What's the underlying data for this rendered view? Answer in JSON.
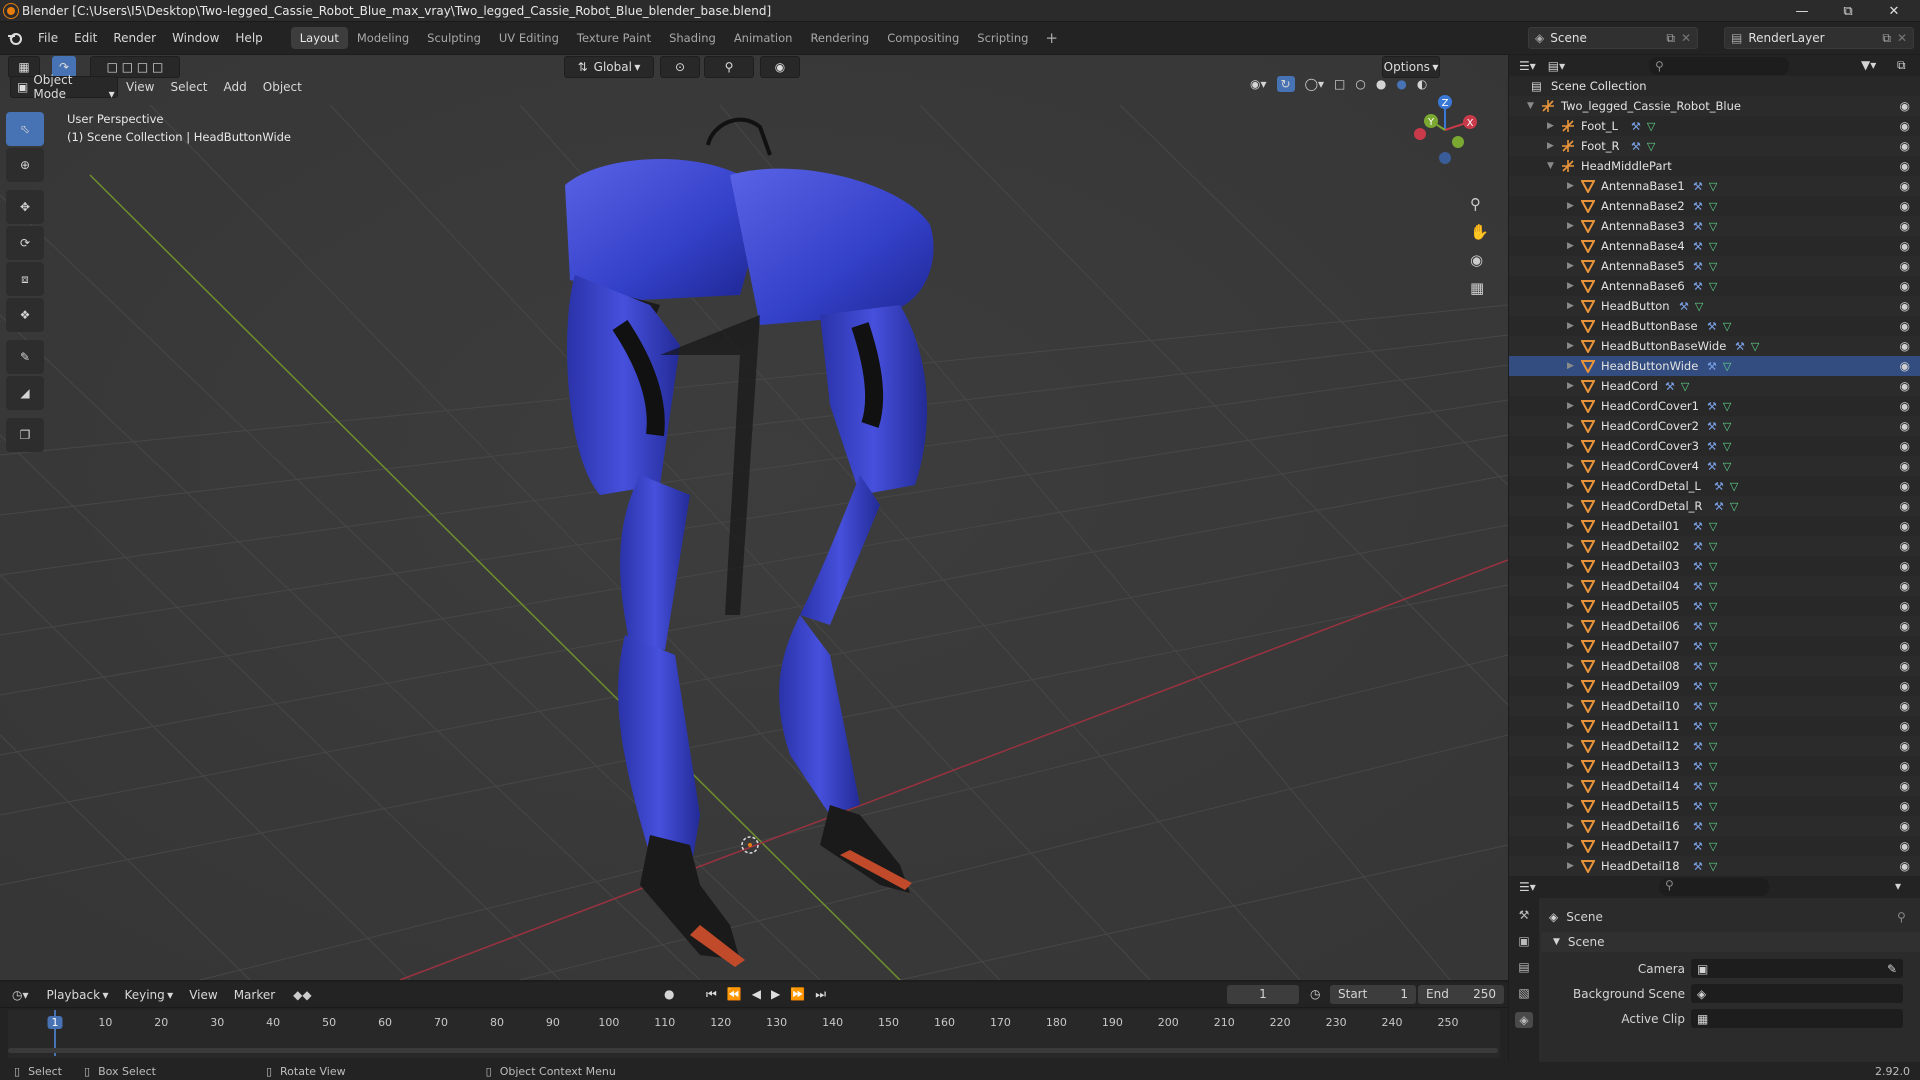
{
  "title": "Blender [C:\\Users\\I5\\Desktop\\Two-legged_Cassie_Robot_Blue_max_vray\\Two_legged_Cassie_Robot_Blue_blender_base.blend]",
  "menus": [
    "File",
    "Edit",
    "Render",
    "Window",
    "Help"
  ],
  "workspaces": [
    "Layout",
    "Modeling",
    "Sculpting",
    "UV Editing",
    "Texture Paint",
    "Shading",
    "Animation",
    "Rendering",
    "Compositing",
    "Scripting"
  ],
  "scene_name": "Scene",
  "render_layer": "RenderLayer",
  "viewport": {
    "mode": "Object Mode",
    "menus": [
      "View",
      "Select",
      "Add",
      "Object"
    ],
    "transform": "Global",
    "options": "Options",
    "perspective": "User Perspective",
    "collection_info": "(1) Scene Collection | HeadButtonWide"
  },
  "gizmo": {
    "x": "X",
    "y": "Y",
    "z": "Z"
  },
  "outliner": {
    "root": "Scene Collection",
    "items": [
      {
        "name": "Two_legged_Cassie_Robot_Blue",
        "depth": 0,
        "open": true,
        "type": "empty",
        "mods": false
      },
      {
        "name": "Foot_L",
        "depth": 1,
        "open": false,
        "type": "empty",
        "mods": true
      },
      {
        "name": "Foot_R",
        "depth": 1,
        "open": false,
        "type": "empty",
        "mods": true
      },
      {
        "name": "HeadMiddlePart",
        "depth": 1,
        "open": true,
        "type": "empty",
        "mods": false
      },
      {
        "name": "AntennaBase1",
        "depth": 2,
        "type": "mesh",
        "mods": true
      },
      {
        "name": "AntennaBase2",
        "depth": 2,
        "type": "mesh",
        "mods": true
      },
      {
        "name": "AntennaBase3",
        "depth": 2,
        "type": "mesh",
        "mods": true
      },
      {
        "name": "AntennaBase4",
        "depth": 2,
        "type": "mesh",
        "mods": true
      },
      {
        "name": "AntennaBase5",
        "depth": 2,
        "type": "mesh",
        "mods": true
      },
      {
        "name": "AntennaBase6",
        "depth": 2,
        "type": "mesh",
        "mods": true
      },
      {
        "name": "HeadButton",
        "depth": 2,
        "type": "mesh",
        "mods": true
      },
      {
        "name": "HeadButtonBase",
        "depth": 2,
        "type": "mesh",
        "mods": true
      },
      {
        "name": "HeadButtonBaseWide",
        "depth": 2,
        "type": "mesh",
        "mods": true
      },
      {
        "name": "HeadButtonWide",
        "depth": 2,
        "type": "mesh",
        "mods": true,
        "active": true
      },
      {
        "name": "HeadCord",
        "depth": 2,
        "type": "mesh",
        "mods": true
      },
      {
        "name": "HeadCordCover1",
        "depth": 2,
        "type": "mesh",
        "mods": true
      },
      {
        "name": "HeadCordCover2",
        "depth": 2,
        "type": "mesh",
        "mods": true
      },
      {
        "name": "HeadCordCover3",
        "depth": 2,
        "type": "mesh",
        "mods": true
      },
      {
        "name": "HeadCordCover4",
        "depth": 2,
        "type": "mesh",
        "mods": true
      },
      {
        "name": "HeadCordDetal_L",
        "depth": 2,
        "type": "mesh",
        "mods": true
      },
      {
        "name": "HeadCordDetal_R",
        "depth": 2,
        "type": "mesh",
        "mods": true
      },
      {
        "name": "HeadDetail01",
        "depth": 2,
        "type": "mesh",
        "mods": true
      },
      {
        "name": "HeadDetail02",
        "depth": 2,
        "type": "mesh",
        "mods": true
      },
      {
        "name": "HeadDetail03",
        "depth": 2,
        "type": "mesh",
        "mods": true
      },
      {
        "name": "HeadDetail04",
        "depth": 2,
        "type": "mesh",
        "mods": true
      },
      {
        "name": "HeadDetail05",
        "depth": 2,
        "type": "mesh",
        "mods": true
      },
      {
        "name": "HeadDetail06",
        "depth": 2,
        "type": "mesh",
        "mods": true
      },
      {
        "name": "HeadDetail07",
        "depth": 2,
        "type": "mesh",
        "mods": true
      },
      {
        "name": "HeadDetail08",
        "depth": 2,
        "type": "mesh",
        "mods": true
      },
      {
        "name": "HeadDetail09",
        "depth": 2,
        "type": "mesh",
        "mods": true
      },
      {
        "name": "HeadDetail10",
        "depth": 2,
        "type": "mesh",
        "mods": true
      },
      {
        "name": "HeadDetail11",
        "depth": 2,
        "type": "mesh",
        "mods": true
      },
      {
        "name": "HeadDetail12",
        "depth": 2,
        "type": "mesh",
        "mods": true
      },
      {
        "name": "HeadDetail13",
        "depth": 2,
        "type": "mesh",
        "mods": true
      },
      {
        "name": "HeadDetail14",
        "depth": 2,
        "type": "mesh",
        "mods": true
      },
      {
        "name": "HeadDetail15",
        "depth": 2,
        "type": "mesh",
        "mods": true
      },
      {
        "name": "HeadDetail16",
        "depth": 2,
        "type": "mesh",
        "mods": true
      },
      {
        "name": "HeadDetail17",
        "depth": 2,
        "type": "mesh",
        "mods": true
      },
      {
        "name": "HeadDetail18",
        "depth": 2,
        "type": "mesh",
        "mods": true
      }
    ]
  },
  "properties": {
    "header": "Scene",
    "panel": "Scene",
    "fields": [
      {
        "label": "Camera",
        "value": ""
      },
      {
        "label": "Background Scene",
        "value": ""
      },
      {
        "label": "Active Clip",
        "value": ""
      }
    ]
  },
  "timeline": {
    "menus": [
      "Playback",
      "Keying",
      "View",
      "Marker"
    ],
    "current_frame": "1",
    "start_label": "Start",
    "start": "1",
    "end_label": "End",
    "end": "250",
    "ticks": [
      "1",
      "10",
      "20",
      "30",
      "40",
      "50",
      "60",
      "70",
      "80",
      "90",
      "100",
      "110",
      "120",
      "130",
      "140",
      "150",
      "160",
      "170",
      "180",
      "190",
      "200",
      "210",
      "220",
      "230",
      "240",
      "250"
    ]
  },
  "status": {
    "select": "Select",
    "box_select": "Box Select",
    "rotate_view": "Rotate View",
    "context_menu": "Object Context Menu",
    "version": "2.92.0"
  },
  "colors": {
    "accent": "#4772b3",
    "robot": "#3a44c8",
    "x_axis": "#c93a4a",
    "y_axis": "#7ba831",
    "z_axis": "#3a78d8",
    "orange": "#e87d0d"
  }
}
